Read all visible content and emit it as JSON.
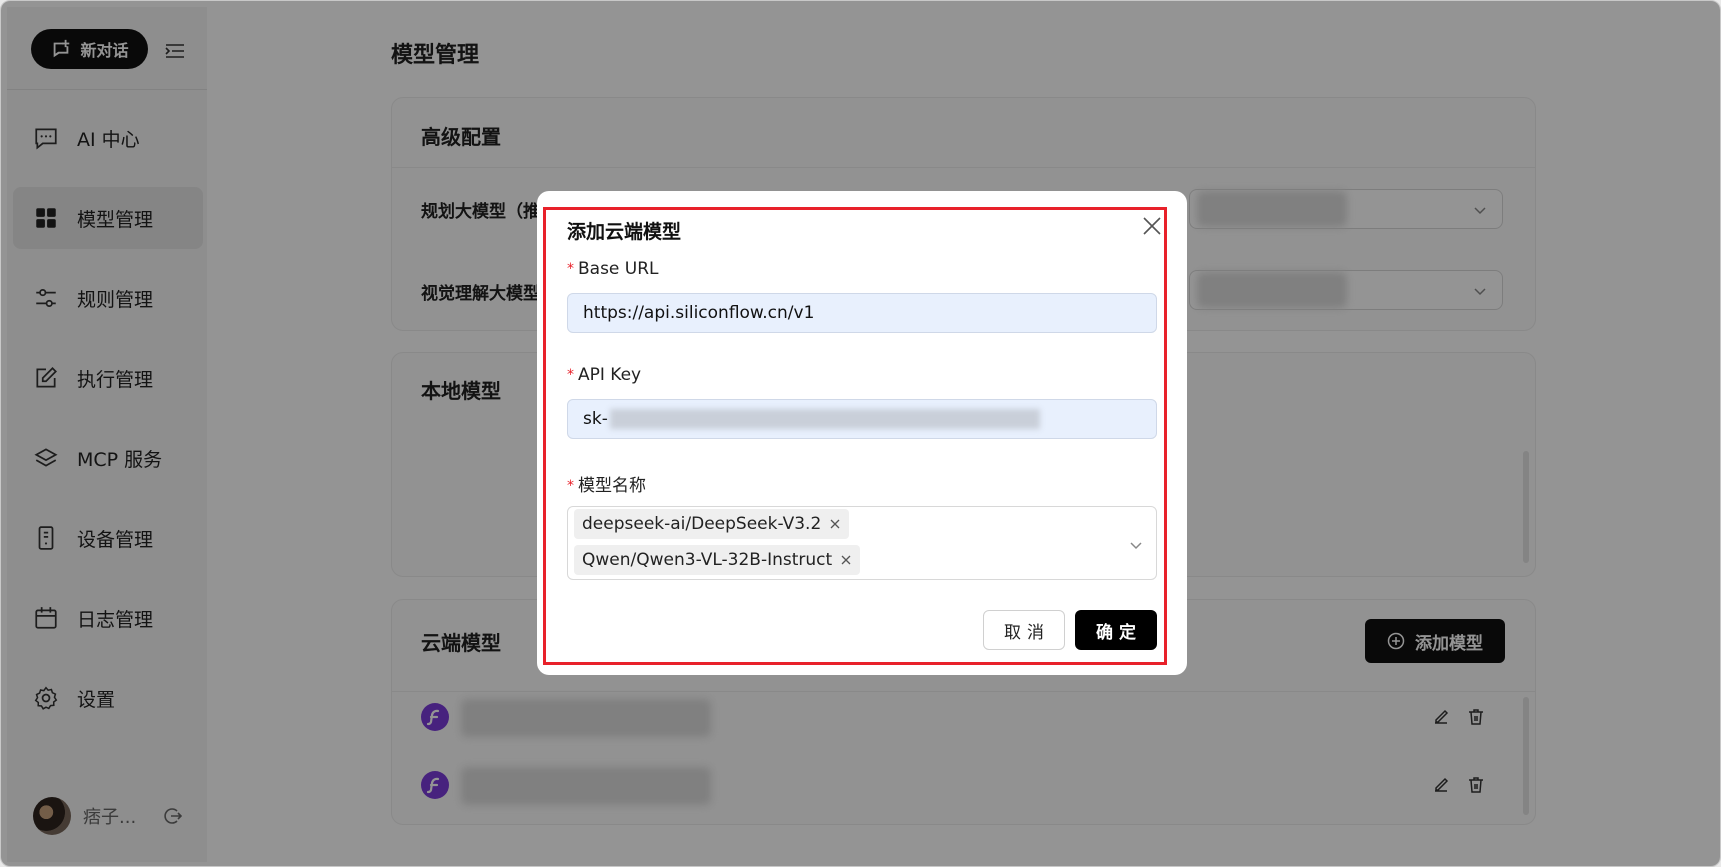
{
  "sidebar": {
    "new_chat_label": "新对话",
    "items": [
      {
        "label": "AI 中心",
        "icon": "chat-icon"
      },
      {
        "label": "模型管理",
        "icon": "grid-icon"
      },
      {
        "label": "规则管理",
        "icon": "sliders-icon"
      },
      {
        "label": "执行管理",
        "icon": "edit-icon"
      },
      {
        "label": "MCP 服务",
        "icon": "layers-icon"
      },
      {
        "label": "设备管理",
        "icon": "device-icon"
      },
      {
        "label": "日志管理",
        "icon": "calendar-icon"
      },
      {
        "label": "设置",
        "icon": "gear-icon"
      }
    ],
    "active_index": 1,
    "user_name": "痞子..."
  },
  "main": {
    "title": "模型管理",
    "advanced": {
      "title": "高级配置",
      "planning_label": "规划大模型（推",
      "vision_label": "视觉理解大模型"
    },
    "local": {
      "title": "本地模型"
    },
    "cloud": {
      "title": "云端模型",
      "add_button": "添加模型"
    }
  },
  "modal": {
    "title": "添加云端模型",
    "base_url_label": "Base URL",
    "base_url_value": "https://api.siliconflow.cn/v1",
    "api_key_label": "API Key",
    "api_key_prefix": "sk-",
    "model_name_label": "模型名称",
    "selected_models": [
      "deepseek-ai/DeepSeek-V3.2",
      "Qwen/Qwen3-VL-32B-Instruct"
    ],
    "required_mark": "*",
    "cancel_label": "取消",
    "ok_label": "确定"
  },
  "colors": {
    "accent": "#111111",
    "highlight": "#e8212a",
    "input_bg": "#e8f0fd",
    "model_logo": "#7a3cd9"
  }
}
